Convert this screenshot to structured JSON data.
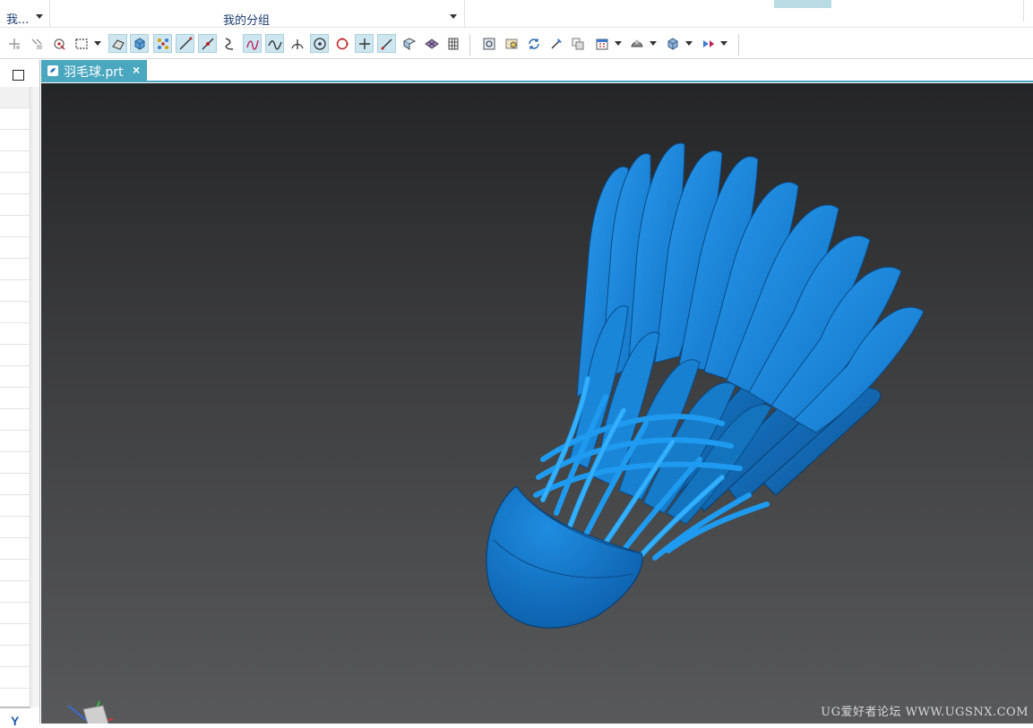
{
  "ribbon": {
    "group_short_label": "我...",
    "group_main_label": "我的分组"
  },
  "toolbar": {
    "icons": [
      "point-icon",
      "point-set-icon",
      "snap-point-icon",
      "selection-box-icon",
      "face-analysis-icon",
      "solid-body-icon",
      "control-points-icon",
      "line-icon",
      "tangent-line-icon",
      "curve-icon",
      "studio-spline-icon",
      "wave-curve-icon",
      "perpendicular-icon",
      "circle-center-icon",
      "circle-icon",
      "cross-icon",
      "diagonal-line-icon",
      "surface-icon",
      "mesh-icon",
      "grid-icon",
      "fit-view-icon",
      "zoom-icon",
      "rotate-icon",
      "pan-icon",
      "layer-icon",
      "calendar-icon",
      "shade-icon",
      "cube-view-icon",
      "render-style-icon"
    ]
  },
  "document": {
    "tab_title": "羽毛球.prt",
    "close_glyph": "×"
  },
  "viewport": {
    "watermark": "UG爱好者论坛 WWW.UGSNX.COM",
    "model_color": "#1d8fe0",
    "background_top": "#242526",
    "background_bottom": "#58595b"
  },
  "leftbar": {
    "axis_label": "Y"
  },
  "colors": {
    "accent": "#4aa7c0",
    "toolbar_active": "#cde6f0"
  }
}
